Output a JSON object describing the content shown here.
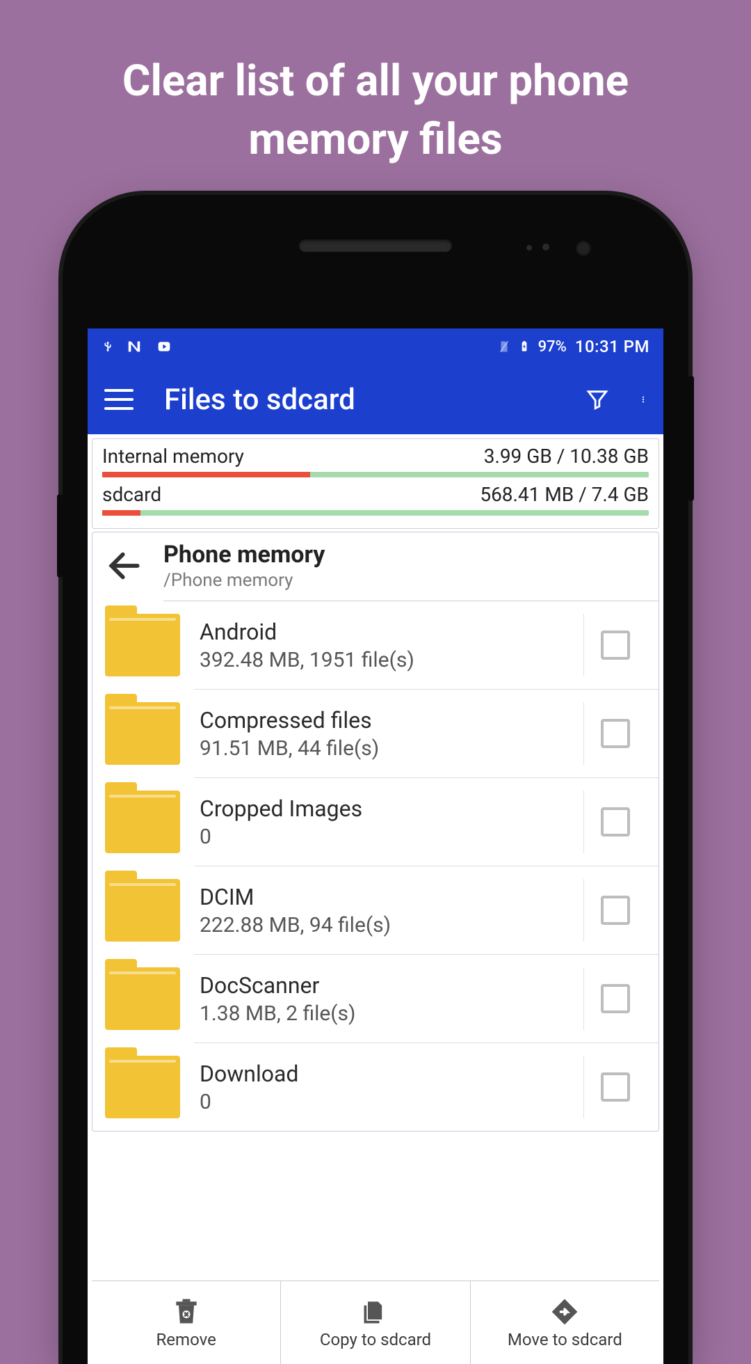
{
  "headline": "Clear list of all your phone memory files",
  "statusbar": {
    "battery_pct": "97%",
    "time": "10:31 PM"
  },
  "appbar": {
    "title": "Files to sdcard"
  },
  "storage": [
    {
      "label": "Internal memory",
      "usage": "3.99 GB / 10.38 GB",
      "fill_pct": 38
    },
    {
      "label": "sdcard",
      "usage": "568.41 MB / 7.4 GB",
      "fill_pct": 7
    }
  ],
  "nav": {
    "title": "Phone memory",
    "path": "/Phone memory"
  },
  "files": [
    {
      "name": "Android",
      "meta": "392.48 MB, 1951 file(s)"
    },
    {
      "name": "Compressed files",
      "meta": "91.51 MB, 44 file(s)"
    },
    {
      "name": "Cropped Images",
      "meta": "0"
    },
    {
      "name": "DCIM",
      "meta": "222.88 MB, 94 file(s)"
    },
    {
      "name": "DocScanner",
      "meta": "1.38 MB, 2 file(s)"
    },
    {
      "name": "Download",
      "meta": "0"
    }
  ],
  "bottom": {
    "remove": "Remove",
    "copy": "Copy to sdcard",
    "move": "Move to sdcard"
  }
}
